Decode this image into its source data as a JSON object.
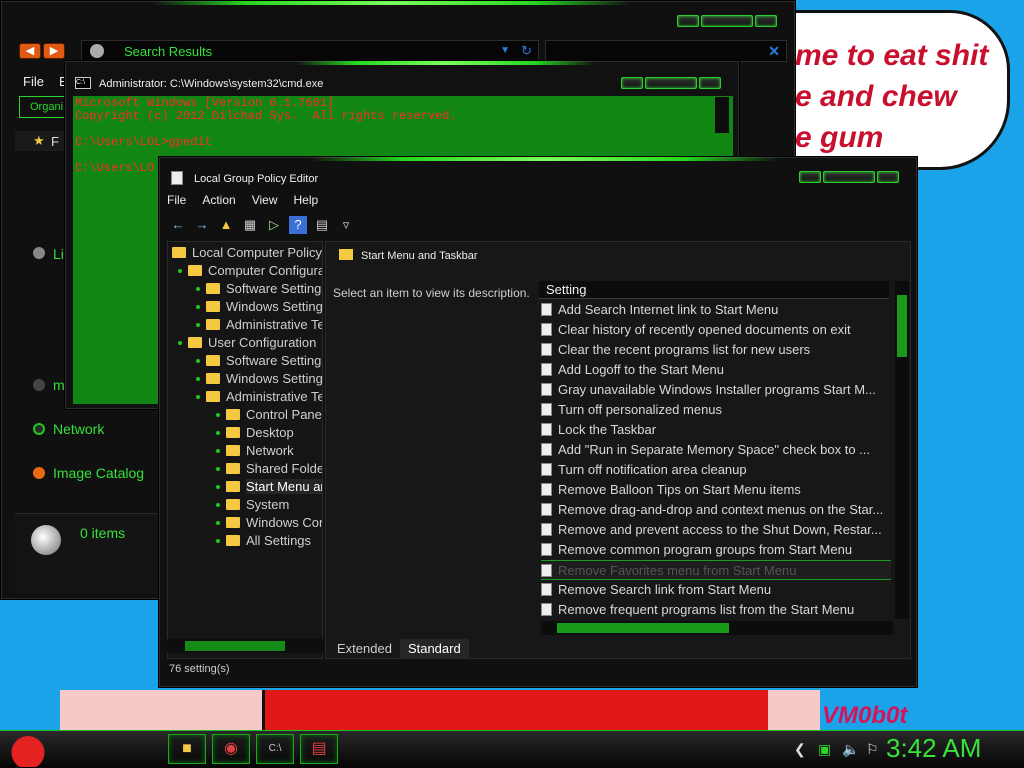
{
  "desktop": {
    "bubble_text": "me to eat shit\ne and chew\ne gum",
    "signature": "VM0b0t"
  },
  "explorer": {
    "address_label": "Search Results",
    "menu_file": "File",
    "menu_e": "E",
    "organize": "Organi",
    "side_links": [
      {
        "label": "Li",
        "icon": "library-icon"
      },
      {
        "label": "m",
        "icon": "music-icon"
      },
      {
        "label": "Network",
        "icon": "network-icon"
      },
      {
        "label": "Image Catalog",
        "icon": "image-catalog-icon"
      }
    ],
    "favorites_label": "F",
    "items_count": "0 items"
  },
  "cmd": {
    "title": "Administrator: C:\\Windows\\system32\\cmd.exe",
    "lines": [
      "Microsoft Windows [Version 6.1.7601]",
      "Copyright (c) 2012 Dilchad Sys.  All rights reserved.",
      "",
      "C:\\Users\\LOL>gpedit",
      "",
      "C:\\Users\\LO"
    ]
  },
  "gpedit": {
    "title": "Local Group Policy Editor",
    "menu": [
      "File",
      "Action",
      "View",
      "Help"
    ],
    "tree": [
      {
        "label": "Local Computer Policy",
        "level": 0
      },
      {
        "label": "Computer Configuration",
        "level": 1
      },
      {
        "label": "Software Settings",
        "level": 2
      },
      {
        "label": "Windows Settings",
        "level": 2
      },
      {
        "label": "Administrative Templates",
        "level": 2
      },
      {
        "label": "User Configuration",
        "level": 1
      },
      {
        "label": "Software Settings",
        "level": 2
      },
      {
        "label": "Windows Settings",
        "level": 2
      },
      {
        "label": "Administrative Templates",
        "level": 2
      },
      {
        "label": "Control Panel",
        "level": 3
      },
      {
        "label": "Desktop",
        "level": 3
      },
      {
        "label": "Network",
        "level": 3
      },
      {
        "label": "Shared Folders",
        "level": 3
      },
      {
        "label": "Start Menu and Taskbar",
        "level": 3,
        "selected": true
      },
      {
        "label": "System",
        "level": 3
      },
      {
        "label": "Windows Components",
        "level": 3
      },
      {
        "label": "All Settings",
        "level": 3
      }
    ],
    "header": "Start Menu and Taskbar",
    "description": "Select an item to view its description.",
    "column_header": "Setting",
    "settings": [
      "Add Search Internet link to Start Menu",
      "Clear history of recently opened documents on exit",
      "Clear the recent programs list for new users",
      "Add Logoff to the Start Menu",
      "Gray unavailable Windows Installer programs Start M...",
      "Turn off personalized menus",
      "Lock the Taskbar",
      "Add \"Run in Separate Memory Space\" check box to ...",
      "Turn off notification area cleanup",
      "Remove Balloon Tips on Start Menu items",
      "Remove drag-and-drop and context menus on the Star...",
      "Remove and prevent access to the Shut Down, Restar...",
      "Remove common program groups from Start Menu",
      "Remove Favorites menu from Start Menu",
      "Remove Search link from Start Menu",
      "Remove frequent programs list from the Start Menu"
    ],
    "highlighted_index": 13,
    "tabs": [
      "Extended",
      "Standard"
    ],
    "active_tab": "Standard",
    "status": "76 setting(s)"
  },
  "taskbar": {
    "apps": [
      "folder-icon",
      "chrome-icon",
      "cmd-icon",
      "gpedit-icon"
    ],
    "clock": "3:42 AM"
  },
  "colors": {
    "accent_green": "#2ad42a",
    "desktop_blue": "#1aa3e8",
    "bubble_red": "#c8102e"
  }
}
